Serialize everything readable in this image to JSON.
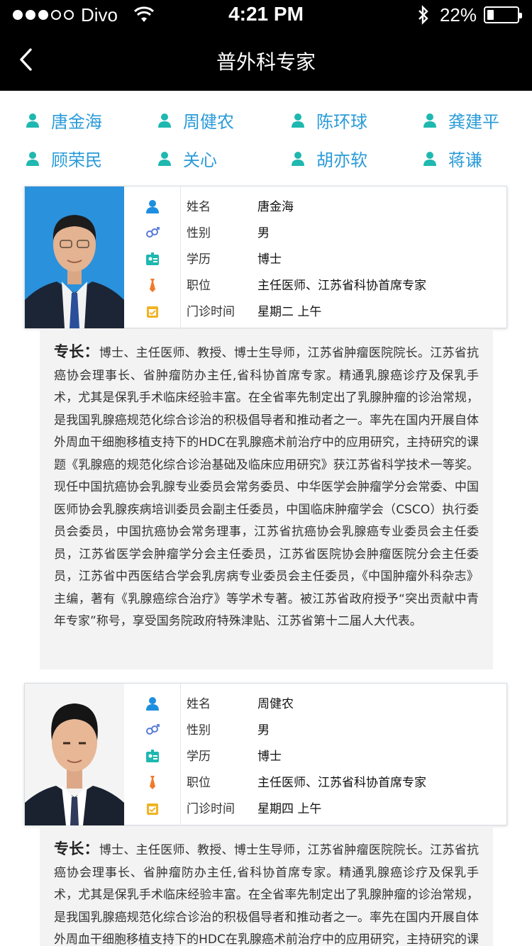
{
  "status": {
    "carrier": "Divo",
    "time": "4:21 PM",
    "battery": "22%",
    "battery_level": 0.22
  },
  "nav": {
    "title": "普外科专家"
  },
  "names": [
    "唐金海",
    "周健农",
    "陈环球",
    "龚建平",
    "顾荣民",
    "关心",
    "胡亦软",
    "蒋谦"
  ],
  "labels": {
    "name": "姓名",
    "gender": "性别",
    "education": "学历",
    "position": "职位",
    "clinic": "门诊时间",
    "specialty": "专长："
  },
  "doctors": [
    {
      "name": "唐金海",
      "gender": "男",
      "education": "博士",
      "position": "主任医师、江苏省科协首席专家",
      "clinic": "星期二 上午",
      "specialty": "博士、主任医师、教授、博士生导师，江苏省肿瘤医院院长。江苏省抗癌协会理事长、省肿瘤防办主任,省科协首席专家。精通乳腺癌诊疗及保乳手术，尤其是保乳手术临床经验丰富。在全省率先制定出了乳腺肿瘤的诊治常规，是我国乳腺癌规范化综合诊治的积极倡导者和推动者之一。率先在国内开展自体外周血干细胞移植支持下的HDC在乳腺癌术前治疗中的应用研究，主持研究的课题《乳腺癌的规范化综合诊治基础及临床应用研究》获江苏省科学技术一等奖。现任中国抗癌协会乳腺专业委员会常务委员、中华医学会肿瘤学分会常委、中国医师协会乳腺疾病培训委员会副主任委员，中国临床肿瘤学会（CSCO）执行委员会委员，中国抗癌协会常务理事，江苏省抗癌协会乳腺癌专业委员会主任委员，江苏省医学会肿瘤学分会主任委员，江苏省医院协会肿瘤医院分会主任委员，江苏省中西医结合学会乳房病专业委员会主任委员，《中国肿瘤外科杂志》主编，著有《乳腺癌综合治疗》等学术专著。被江苏省政府授予“突出贡献中青年专家”称号，享受国务院政府特殊津贴、江苏省第十二届人大代表。"
    },
    {
      "name": "周健农",
      "gender": "男",
      "education": "博士",
      "position": "主任医师、江苏省科协首席专家",
      "clinic": "星期四 上午",
      "specialty": "博士、主任医师、教授、博士生导师，江苏省肿瘤医院院长。江苏省抗癌协会理事长、省肿瘤防办主任,省科协首席专家。精通乳腺癌诊疗及保乳手术，尤其是保乳手术临床经验丰富。在全省率先制定出了乳腺肿瘤的诊治常规，是我国乳腺癌规范化综合诊治的积极倡导者和推动者之一。率先在国内开展自体外周血干细胞移植支持下的HDC在乳腺癌术前治疗中的应用研究，主持研究的课题《乳腺癌的规范化综合诊治基础及临床应用研究》获江苏省科学技术一等奖。"
    }
  ],
  "colors": {
    "accent": "#2a9bd8",
    "icon_teal": "#1fb8b0",
    "icon_orange": "#f07a2a",
    "icon_yellow": "#f0b323"
  }
}
